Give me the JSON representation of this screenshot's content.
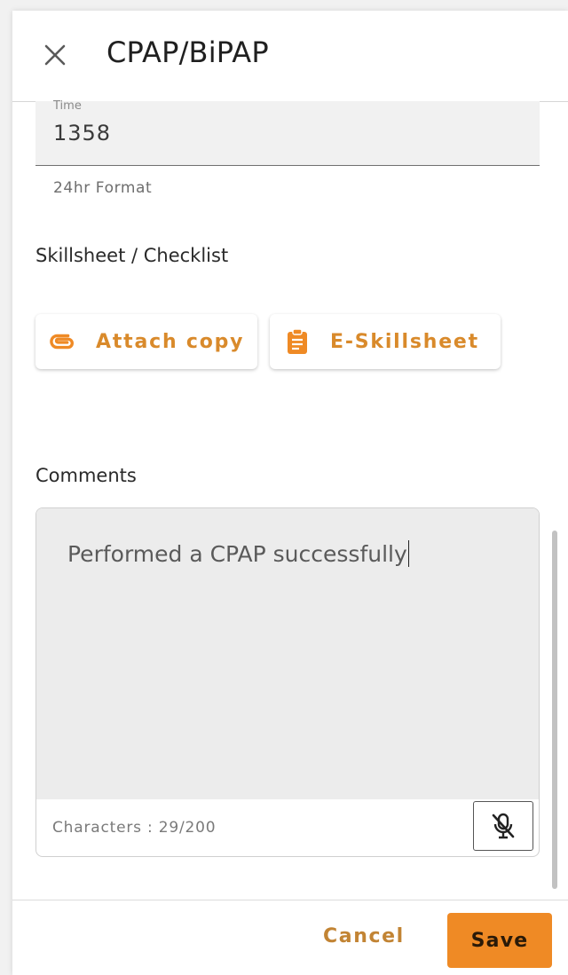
{
  "header": {
    "title": "CPAP/BiPAP"
  },
  "time": {
    "label": "Time",
    "value": "1358",
    "hint": "24hr Format"
  },
  "skillsheet": {
    "section_label": "Skillsheet / Checklist",
    "attach_label": "Attach copy",
    "eskill_label": "E-Skillsheet"
  },
  "comments": {
    "section_label": "Comments",
    "text": "Performed a CPAP successfully",
    "char_count": "Characters : 29/200"
  },
  "footer": {
    "cancel_label": "Cancel",
    "save_label": "Save"
  },
  "colors": {
    "accent": "#ef8a25",
    "accent_text": "#d98a2b"
  },
  "icons": {
    "close": "close-icon",
    "attach": "paperclip-icon",
    "eskill": "clipboard-icon",
    "mic": "mic-off-icon"
  }
}
